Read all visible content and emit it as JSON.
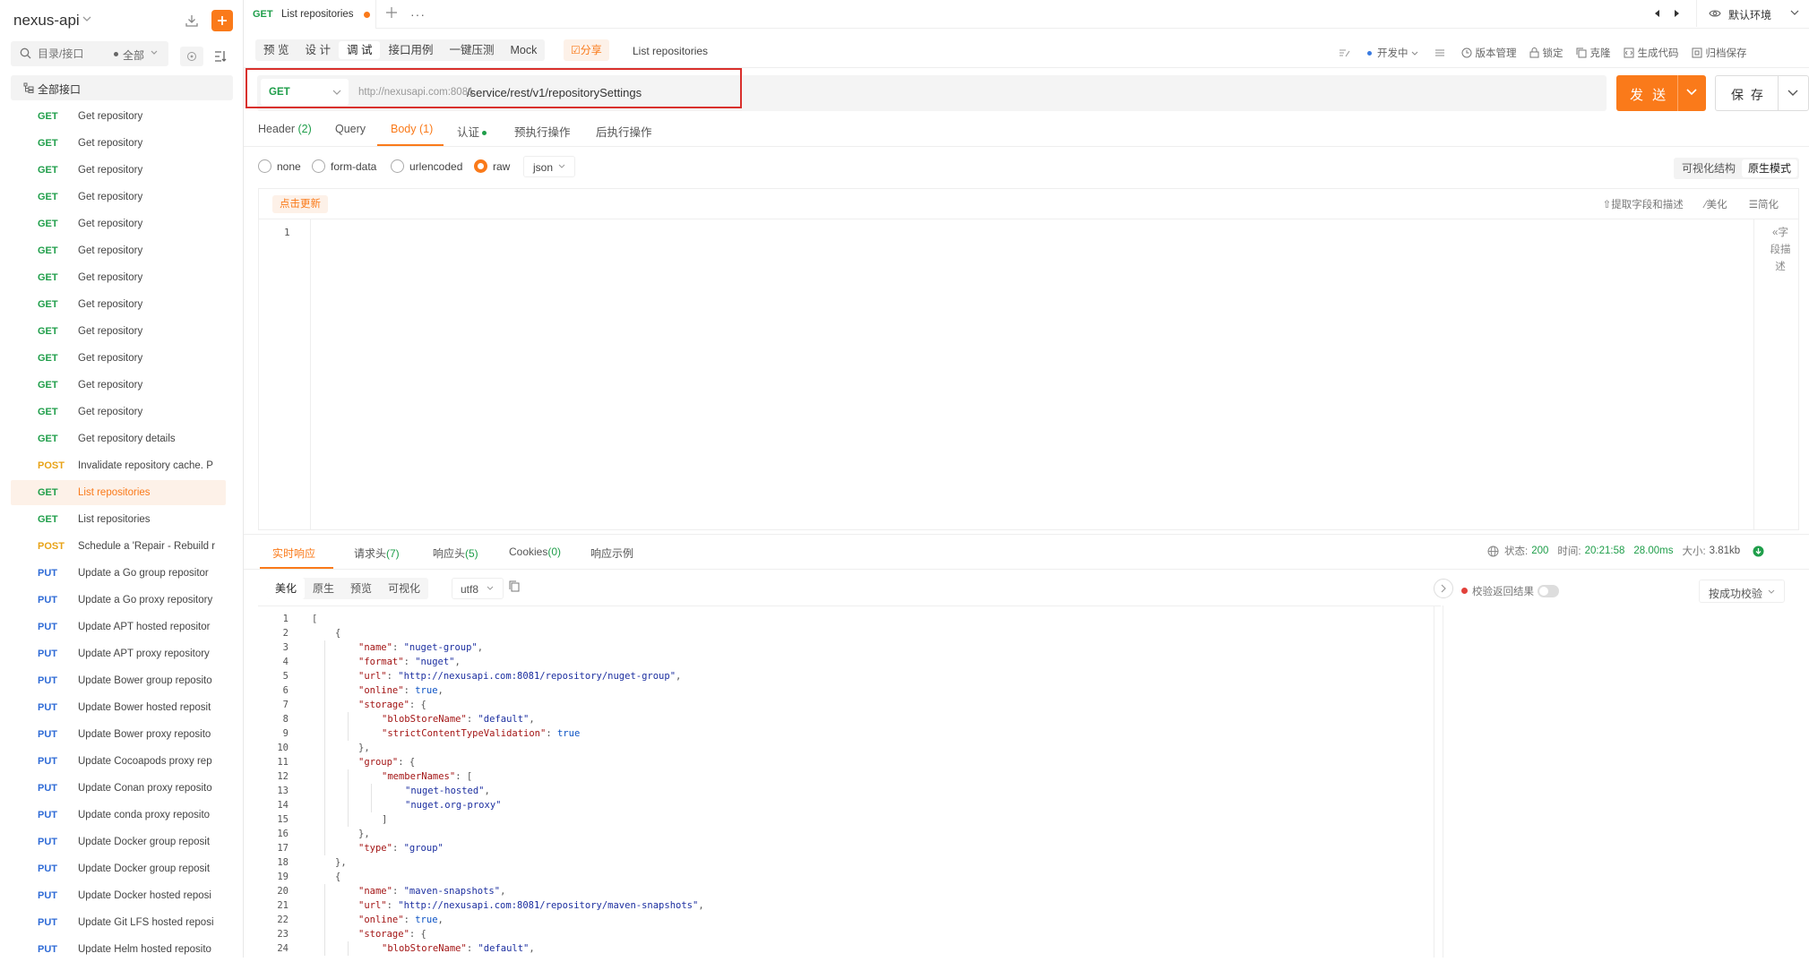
{
  "sidebar": {
    "project_name": "nexus-api",
    "search_placeholder": "目录/接口",
    "filter_label": "全部",
    "all_apis_label": "全部接口",
    "items": [
      {
        "method": "GET",
        "name": "Get repository"
      },
      {
        "method": "GET",
        "name": "Get repository"
      },
      {
        "method": "GET",
        "name": "Get repository"
      },
      {
        "method": "GET",
        "name": "Get repository"
      },
      {
        "method": "GET",
        "name": "Get repository"
      },
      {
        "method": "GET",
        "name": "Get repository"
      },
      {
        "method": "GET",
        "name": "Get repository"
      },
      {
        "method": "GET",
        "name": "Get repository"
      },
      {
        "method": "GET",
        "name": "Get repository"
      },
      {
        "method": "GET",
        "name": "Get repository"
      },
      {
        "method": "GET",
        "name": "Get repository"
      },
      {
        "method": "GET",
        "name": "Get repository"
      },
      {
        "method": "GET",
        "name": "Get repository details"
      },
      {
        "method": "POST",
        "name": "Invalidate repository cache. P"
      },
      {
        "method": "GET",
        "name": "List repositories",
        "active": true
      },
      {
        "method": "GET",
        "name": "List repositories"
      },
      {
        "method": "POST",
        "name": "Schedule a 'Repair - Rebuild r"
      },
      {
        "method": "PUT",
        "name": "Update a Go group repositor"
      },
      {
        "method": "PUT",
        "name": "Update a Go proxy repository"
      },
      {
        "method": "PUT",
        "name": "Update APT hosted repositor"
      },
      {
        "method": "PUT",
        "name": "Update APT proxy repository"
      },
      {
        "method": "PUT",
        "name": "Update Bower group reposito"
      },
      {
        "method": "PUT",
        "name": "Update Bower hosted reposit"
      },
      {
        "method": "PUT",
        "name": "Update Bower proxy reposito"
      },
      {
        "method": "PUT",
        "name": "Update Cocoapods proxy rep"
      },
      {
        "method": "PUT",
        "name": "Update Conan proxy reposito"
      },
      {
        "method": "PUT",
        "name": "Update conda proxy reposito"
      },
      {
        "method": "PUT",
        "name": "Update Docker group reposit"
      },
      {
        "method": "PUT",
        "name": "Update Docker group reposit"
      },
      {
        "method": "PUT",
        "name": "Update Docker hosted reposi"
      },
      {
        "method": "PUT",
        "name": "Update Git LFS hosted reposi"
      },
      {
        "method": "PUT",
        "name": "Update Helm hosted reposito"
      }
    ]
  },
  "tabs": {
    "current": {
      "method": "GET",
      "title": "List repositories"
    },
    "more": "···",
    "env_label": "默认环境"
  },
  "mode": {
    "tabs": [
      "预 览",
      "设 计",
      "调 试",
      "接口用例",
      "一键压测",
      "Mock"
    ],
    "active_index": 2,
    "share_label": "☑分享",
    "api_title": "List repositories",
    "toolbar": {
      "status": "开发中",
      "version": "版本管理",
      "lock": "锁定",
      "clone": "克隆",
      "gen_code": "生成代码",
      "archive": "归档保存"
    }
  },
  "request": {
    "method": "GET",
    "base_url": "http://nexusapi.com:8081",
    "path": "/service/rest/v1/repositorySettings",
    "send_label": "发 送",
    "save_label": "保 存"
  },
  "req_tabs": {
    "header": "Header",
    "header_count": "(2)",
    "query": "Query",
    "body": "Body",
    "body_count": "(1)",
    "auth": "认证",
    "pre": "预执行操作",
    "post": "后执行操作"
  },
  "body": {
    "types": [
      "none",
      "form-data",
      "urlencoded",
      "raw"
    ],
    "selected": "raw",
    "format": "json",
    "view_modes": [
      "可视化结构",
      "原生模式"
    ],
    "view_active": "原生模式",
    "refresh_label": "点击更新",
    "tools": [
      "⇧提取字段和描述",
      "⁄美化",
      "☰简化"
    ],
    "line_number": "1",
    "side_label": "«字段描述"
  },
  "response": {
    "tabs": [
      {
        "label": "实时响应",
        "count": ""
      },
      {
        "label": "请求头",
        "count": "(7)"
      },
      {
        "label": "响应头",
        "count": "(5)"
      },
      {
        "label": "Cookies",
        "count": "(0)"
      },
      {
        "label": "响应示例",
        "count": ""
      }
    ],
    "status_label": "状态:",
    "status": "200",
    "time_label": "时间:",
    "time": "20:21:58",
    "duration": "28.00ms",
    "size_label": "大小:",
    "size": "3.81kb",
    "view_tabs": [
      "美化",
      "原生",
      "预览",
      "可视化"
    ],
    "encoding": "utf8",
    "verify_label": "校验返回结果",
    "verify_select": "按成功校验",
    "lines": [
      {
        "n": "1",
        "indent": 0,
        "t": [
          [
            "p",
            "["
          ]
        ]
      },
      {
        "n": "2",
        "indent": 1,
        "t": [
          [
            "p",
            "{"
          ]
        ]
      },
      {
        "n": "3",
        "indent": 2,
        "t": [
          [
            "k",
            "\"name\""
          ],
          [
            "p",
            ": "
          ],
          [
            "s",
            "\"nuget-group\""
          ],
          [
            "p",
            ","
          ]
        ]
      },
      {
        "n": "4",
        "indent": 2,
        "t": [
          [
            "k",
            "\"format\""
          ],
          [
            "p",
            ": "
          ],
          [
            "s",
            "\"nuget\""
          ],
          [
            "p",
            ","
          ]
        ]
      },
      {
        "n": "5",
        "indent": 2,
        "t": [
          [
            "k",
            "\"url\""
          ],
          [
            "p",
            ": "
          ],
          [
            "s",
            "\"http://nexusapi.com:8081/repository/nuget-group\""
          ],
          [
            "p",
            ","
          ]
        ]
      },
      {
        "n": "6",
        "indent": 2,
        "t": [
          [
            "k",
            "\"online\""
          ],
          [
            "p",
            ": "
          ],
          [
            "b",
            "true"
          ],
          [
            "p",
            ","
          ]
        ]
      },
      {
        "n": "7",
        "indent": 2,
        "t": [
          [
            "k",
            "\"storage\""
          ],
          [
            "p",
            ": {"
          ]
        ]
      },
      {
        "n": "8",
        "indent": 3,
        "t": [
          [
            "k",
            "\"blobStoreName\""
          ],
          [
            "p",
            ": "
          ],
          [
            "s",
            "\"default\""
          ],
          [
            "p",
            ","
          ]
        ]
      },
      {
        "n": "9",
        "indent": 3,
        "t": [
          [
            "k",
            "\"strictContentTypeValidation\""
          ],
          [
            "p",
            ": "
          ],
          [
            "b",
            "true"
          ]
        ]
      },
      {
        "n": "10",
        "indent": 2,
        "t": [
          [
            "p",
            "},"
          ]
        ]
      },
      {
        "n": "11",
        "indent": 2,
        "t": [
          [
            "k",
            "\"group\""
          ],
          [
            "p",
            ": {"
          ]
        ]
      },
      {
        "n": "12",
        "indent": 3,
        "t": [
          [
            "k",
            "\"memberNames\""
          ],
          [
            "p",
            ": ["
          ]
        ]
      },
      {
        "n": "13",
        "indent": 4,
        "t": [
          [
            "s",
            "\"nuget-hosted\""
          ],
          [
            "p",
            ","
          ]
        ]
      },
      {
        "n": "14",
        "indent": 4,
        "t": [
          [
            "s",
            "\"nuget.org-proxy\""
          ]
        ]
      },
      {
        "n": "15",
        "indent": 3,
        "t": [
          [
            "p",
            "]"
          ]
        ]
      },
      {
        "n": "16",
        "indent": 2,
        "t": [
          [
            "p",
            "},"
          ]
        ]
      },
      {
        "n": "17",
        "indent": 2,
        "t": [
          [
            "k",
            "\"type\""
          ],
          [
            "p",
            ": "
          ],
          [
            "s",
            "\"group\""
          ]
        ]
      },
      {
        "n": "18",
        "indent": 1,
        "t": [
          [
            "p",
            "},"
          ]
        ]
      },
      {
        "n": "19",
        "indent": 1,
        "t": [
          [
            "p",
            "{"
          ]
        ]
      },
      {
        "n": "20",
        "indent": 2,
        "t": [
          [
            "k",
            "\"name\""
          ],
          [
            "p",
            ": "
          ],
          [
            "s",
            "\"maven-snapshots\""
          ],
          [
            "p",
            ","
          ]
        ]
      },
      {
        "n": "21",
        "indent": 2,
        "t": [
          [
            "k",
            "\"url\""
          ],
          [
            "p",
            ": "
          ],
          [
            "s",
            "\"http://nexusapi.com:8081/repository/maven-snapshots\""
          ],
          [
            "p",
            ","
          ]
        ]
      },
      {
        "n": "22",
        "indent": 2,
        "t": [
          [
            "k",
            "\"online\""
          ],
          [
            "p",
            ": "
          ],
          [
            "b",
            "true"
          ],
          [
            "p",
            ","
          ]
        ]
      },
      {
        "n": "23",
        "indent": 2,
        "t": [
          [
            "k",
            "\"storage\""
          ],
          [
            "p",
            ": {"
          ]
        ]
      },
      {
        "n": "24",
        "indent": 3,
        "t": [
          [
            "k",
            "\"blobStoreName\""
          ],
          [
            "p",
            ": "
          ],
          [
            "s",
            "\"default\""
          ],
          [
            "p",
            ","
          ]
        ]
      }
    ]
  },
  "colors": {
    "accent": "#fa7a1a",
    "get": "#1f9e4a",
    "post": "#e8a317",
    "put": "#2f6bd6",
    "highlight_box": "#d9302c"
  }
}
